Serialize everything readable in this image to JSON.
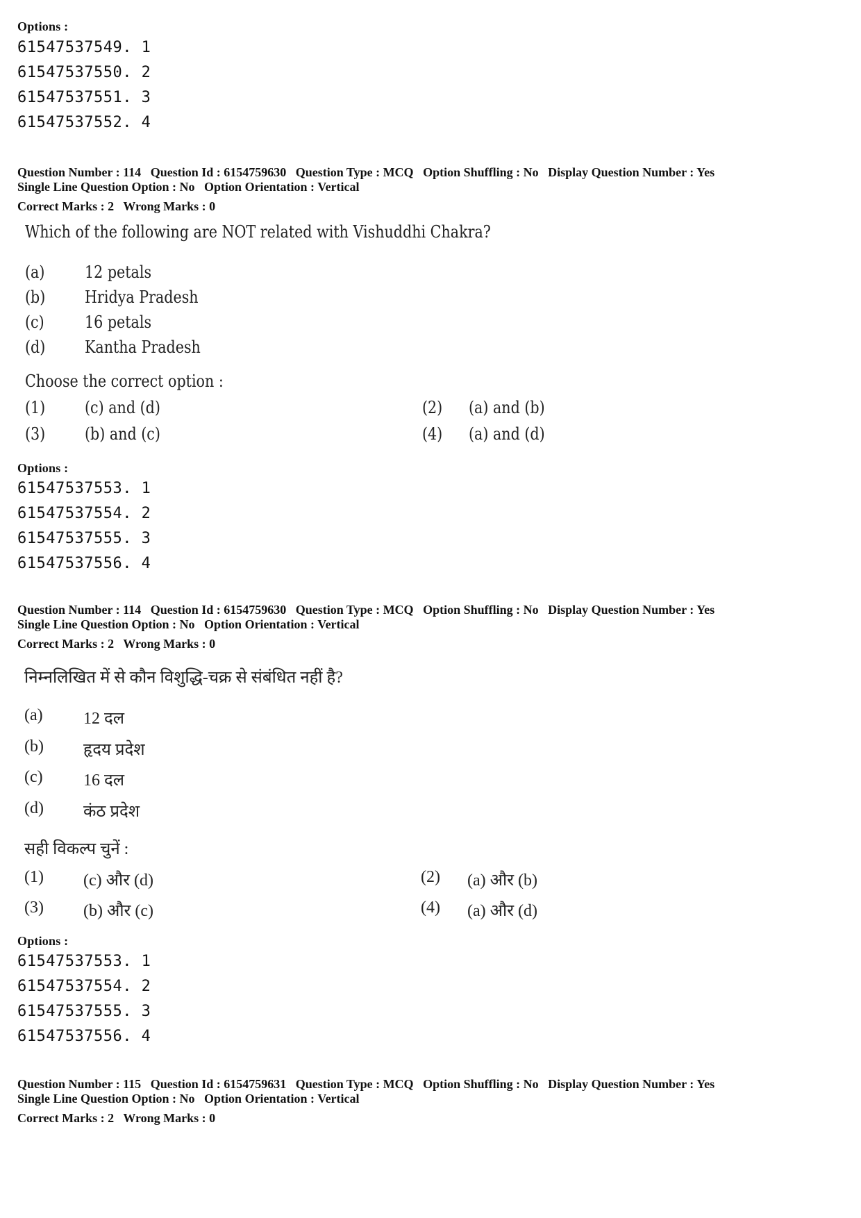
{
  "top_options": {
    "heading": "Options :",
    "items": [
      "61547537549. 1",
      "61547537550. 2",
      "61547537551. 3",
      "61547537552. 4"
    ]
  },
  "question_en": {
    "meta": {
      "line1": [
        "Question Number : 114",
        "Question Id : 6154759630",
        "Question Type : MCQ",
        "Option Shuffling : No",
        "Display Question Number : Yes"
      ],
      "line2": [
        "Single Line Question Option : No",
        "Option Orientation : Vertical"
      ],
      "line3": [
        "Correct Marks : 2",
        "Wrong Marks : 0"
      ]
    },
    "text": "Which of the following are NOT related with Vishuddhi Chakra?",
    "items": [
      {
        "label": "(a)",
        "text": "12 petals"
      },
      {
        "label": "(b)",
        "text": "Hridya Pradesh"
      },
      {
        "label": "(c)",
        "text": "16 petals"
      },
      {
        "label": "(d)",
        "text": "Kantha Pradesh"
      }
    ],
    "choose_label": "Choose the correct option :",
    "answers": [
      {
        "num": "(1)",
        "text": "(c) and (d)"
      },
      {
        "num": "(2)",
        "text": "(a) and (b)"
      },
      {
        "num": "(3)",
        "text": "(b) and (c)"
      },
      {
        "num": "(4)",
        "text": "(a) and (d)"
      }
    ],
    "options_heading": "Options :",
    "options": [
      "61547537553. 1",
      "61547537554. 2",
      "61547537555. 3",
      "61547537556. 4"
    ]
  },
  "question_hi": {
    "meta": {
      "line1": [
        "Question Number : 114",
        "Question Id : 6154759630",
        "Question Type : MCQ",
        "Option Shuffling : No",
        "Display Question Number : Yes"
      ],
      "line2": [
        "Single Line Question Option : No",
        "Option Orientation : Vertical"
      ],
      "line3": [
        "Correct Marks : 2",
        "Wrong Marks : 0"
      ]
    },
    "text": "निम्नलिखित में से कौन विशुद्धि-चक्र से संबंधित नहीं है?",
    "items": [
      {
        "label": "(a)",
        "text": "12 दल"
      },
      {
        "label": "(b)",
        "text": "हृदय प्रदेश"
      },
      {
        "label": "(c)",
        "text": "16 दल"
      },
      {
        "label": "(d)",
        "text": "कंठ प्रदेश"
      }
    ],
    "choose_label": "सही विकल्प चुनें :",
    "answers": [
      {
        "num": "(1)",
        "text": "(c) और (d)"
      },
      {
        "num": "(2)",
        "text": "(a) और (b)"
      },
      {
        "num": "(3)",
        "text": "(b) और (c)"
      },
      {
        "num": "(4)",
        "text": "(a) और (d)"
      }
    ],
    "options_heading": "Options :",
    "options": [
      "61547537553. 1",
      "61547537554. 2",
      "61547537555. 3",
      "61547537556. 4"
    ]
  },
  "question_next": {
    "meta": {
      "line1": [
        "Question Number : 115",
        "Question Id : 6154759631",
        "Question Type : MCQ",
        "Option Shuffling : No",
        "Display Question Number : Yes"
      ],
      "line2": [
        "Single Line Question Option : No",
        "Option Orientation : Vertical"
      ],
      "line3": [
        "Correct Marks : 2",
        "Wrong Marks : 0"
      ]
    }
  }
}
